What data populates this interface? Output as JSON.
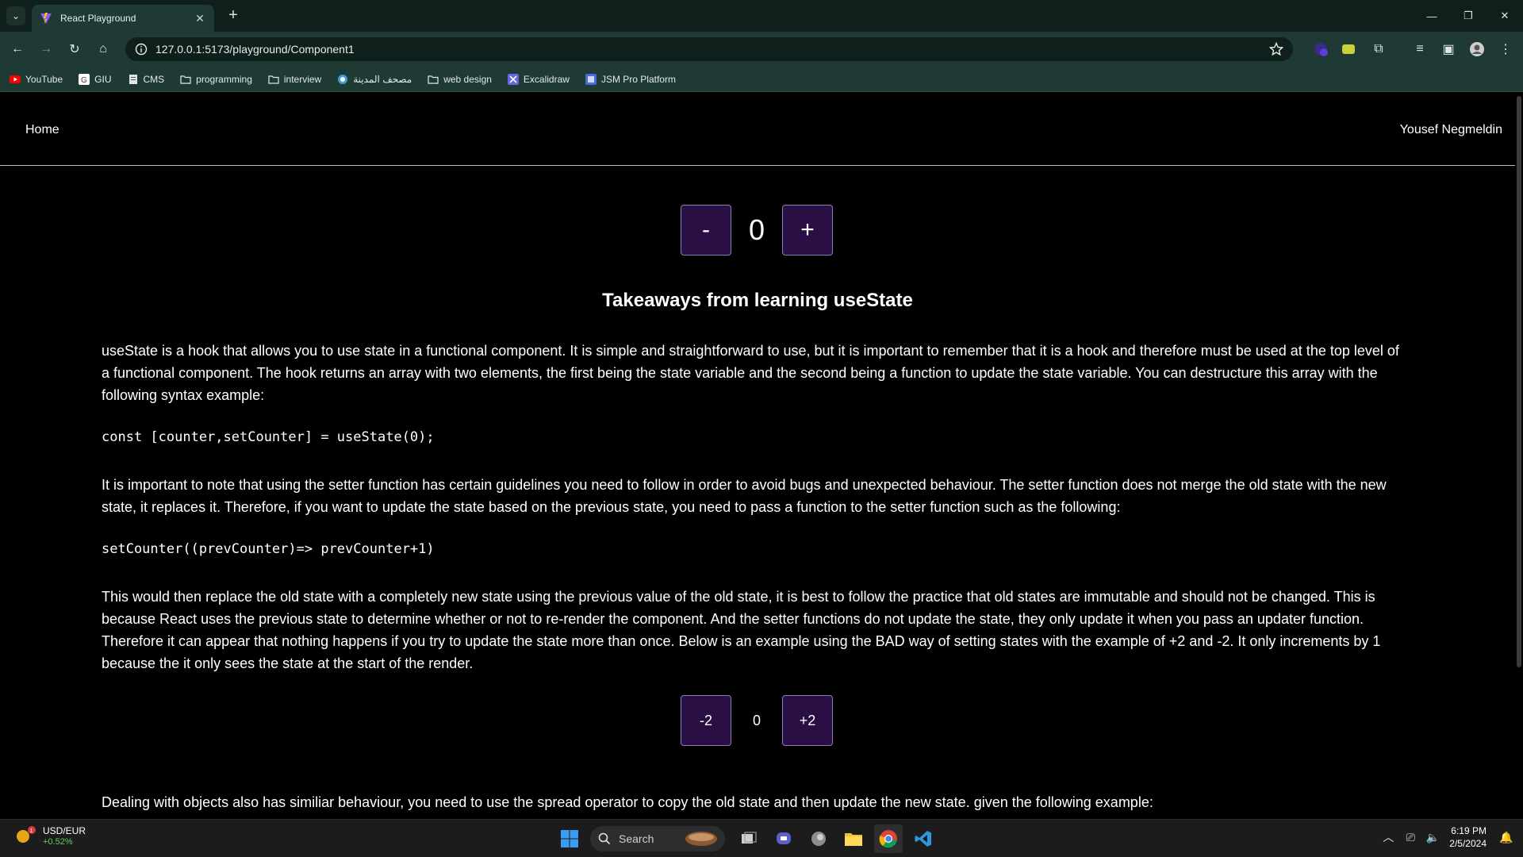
{
  "browser": {
    "tab_title": "React Playground",
    "url": "127.0.0.1:5173/playground/Component1",
    "bookmarks": [
      {
        "label": "YouTube",
        "icon": "youtube-icon"
      },
      {
        "label": "GIU",
        "icon": "google-icon"
      },
      {
        "label": "CMS",
        "icon": "document-icon"
      },
      {
        "label": "programming",
        "icon": "folder-icon"
      },
      {
        "label": "interview",
        "icon": "folder-icon"
      },
      {
        "label": "مصحف المدينة",
        "icon": "globe-icon"
      },
      {
        "label": "web design",
        "icon": "folder-icon"
      },
      {
        "label": "Excalidraw",
        "icon": "excalidraw-icon"
      },
      {
        "label": "JSM Pro Platform",
        "icon": "jsm-icon"
      }
    ]
  },
  "nav": {
    "home": "Home",
    "user": "Yousef Negmeldin"
  },
  "counter": {
    "minus": "-",
    "value": "0",
    "plus": "+"
  },
  "heading": "Takeaways from learning useState",
  "paragraphs": {
    "p1": "useState is a hook that allows you to use state in a functional component. It is simple and straightforward to use, but it is important to remember that it is a hook and therefore must be used at the top level of a functional component. The hook returns an array with two elements, the first being the state variable and the second being a function to update the state variable. You can destructure this array with the following syntax example:",
    "code1": "const [counter,setCounter] = useState(0);",
    "p2": "It is important to note that using the setter function has certain guidelines you need to follow in order to avoid bugs and unexpected behaviour. The setter function does not merge the old state with the new state, it replaces it. Therefore, if you want to update the state based on the previous state, you need to pass a function to the setter function such as the following:",
    "code2": "setCounter((prevCounter)=> prevCounter+1)",
    "p3": "This would then replace the old state with a completely new state using the previous value of the old state, it is best to follow the practice that old states are immutable and should not be changed. This is because React uses the previous state to determine whether or not to re-render the component. And the setter functions do not update the state, they only update it when you pass an updater function. Therefore it can appear that nothing happens if you try to update the state more than once. Below is an example using the BAD way of setting states with the example of +2 and -2. It only increments by 1 because the it only sees the state at the start of the render.",
    "p4": "Dealing with objects also has similiar behaviour, you need to use the spread operator to copy the old state and then update the new state. given the following example:"
  },
  "counter2": {
    "minus": "-2",
    "value": "0",
    "plus": "+2"
  },
  "taskbar": {
    "widget_title": "USD/EUR",
    "widget_change": "+0.52%",
    "widget_badge": "1",
    "search": "Search",
    "time": "6:19 PM",
    "date": "2/5/2024"
  },
  "colors": {
    "chrome_dark": "#0f1f1c",
    "chrome_tab": "#1f3a34",
    "button_bg": "#2a0f44",
    "button_border": "#8e7bb0"
  }
}
